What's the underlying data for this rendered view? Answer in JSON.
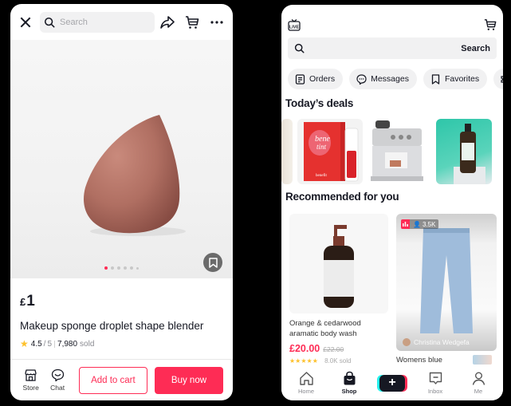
{
  "product_page": {
    "search": {
      "placeholder": "Search"
    },
    "icons": {
      "close": "close-icon",
      "share": "share-icon",
      "cart": "cart-icon",
      "more": "more-icon"
    },
    "gallery": {
      "image": "makeup-sponge",
      "slide_count": 6,
      "active_slide": 1
    },
    "price": {
      "currency": "£",
      "amount": "1"
    },
    "title": "Makeup sponge droplet shape blender",
    "rating": {
      "value": "4.5",
      "max": "5",
      "sold_count": "7,980",
      "sold_label": "sold"
    },
    "bottom_bar": {
      "store_label": "Store",
      "chat_label": "Chat",
      "add_to_cart_label": "Add to cart",
      "buy_now_label": "Buy now"
    },
    "accent_color": "#fe2c55"
  },
  "shop_page": {
    "search": {
      "button_label": "Search"
    },
    "chips": [
      {
        "label": "Orders",
        "icon": "orders-icon"
      },
      {
        "label": "Messages",
        "icon": "messages-icon"
      },
      {
        "label": "Favorites",
        "icon": "favorites-icon"
      },
      {
        "label": "",
        "icon": "coupon-icon"
      }
    ],
    "todays_deals": {
      "title": "Today’s deals",
      "items": [
        {
          "image": "partial-product"
        },
        {
          "image": "benetint-lip-stain",
          "brand_text": "bene tint",
          "sub_text": "benefit"
        },
        {
          "image": "espresso-machine"
        },
        {
          "image": "hair-oil-bottle"
        }
      ]
    },
    "recommended": {
      "title": "Recommended for you",
      "items": [
        {
          "image": "body-wash-bottle",
          "name": "Orange & cedarwood aramatic body wash",
          "price": "£20.00",
          "original_price": "£22.00",
          "stars": "★★★★★",
          "sold": "8.0K sold"
        },
        {
          "image": "blue-trousers",
          "live_viewers": "3.5K",
          "creator": "Christina Wedgefa",
          "name": "Womens blue"
        }
      ]
    },
    "nav": [
      {
        "label": "Home",
        "icon": "home-icon",
        "active": false
      },
      {
        "label": "Shop",
        "icon": "shop-bag-icon",
        "active": true
      },
      {
        "label": "",
        "icon": "create-plus-icon",
        "active": false
      },
      {
        "label": "Inbox",
        "icon": "inbox-icon",
        "active": false
      },
      {
        "label": "Me",
        "icon": "profile-icon",
        "active": false
      }
    ]
  }
}
